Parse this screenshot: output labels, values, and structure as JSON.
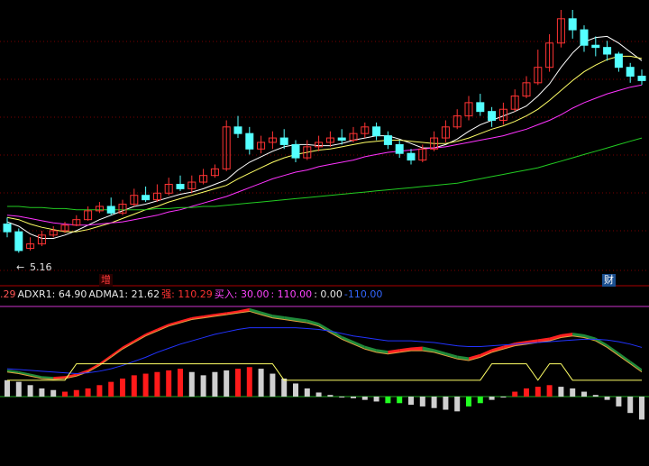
{
  "colors": {
    "background": "#000000",
    "grid": "#7a0000",
    "up_candle": "#ff3333",
    "down_candle": "#54ffff",
    "ma_white": "#ffffff",
    "ma_yellow": "#ffff66",
    "ma_magenta": "#ff33ff",
    "ma_green": "#22cc22",
    "adx_red": "#ff2020",
    "adx_green": "#1f8a3a",
    "adxr_blue": "#2233ff",
    "hist_red": "#ff1a1a",
    "hist_grey": "#cfcfcf",
    "hist_green": "#22ff22"
  },
  "price_panel": {
    "low_marker": "5.16",
    "low_arrow": "←",
    "tag_increase": "增",
    "tag_finance": "财"
  },
  "indicator_bar": {
    "items": [
      {
        "label": "",
        "value": ".29",
        "color": "#ff5555"
      },
      {
        "label": "ADXR1: ",
        "value": "64.90",
        "color": "#e8e8e8"
      },
      {
        "label": "ADMA1: ",
        "value": "21.62",
        "color": "#e8e8e8"
      },
      {
        "label": "强: ",
        "value": "110.29",
        "color": "#ff3333"
      },
      {
        "label": "买入: ",
        "value": "30.00",
        "color": "#ff44ff"
      },
      {
        "label": ": ",
        "value": "110.00",
        "color": "#ff44ff"
      },
      {
        "label": ": ",
        "value": "0.00",
        "color": "#e8e8e8"
      },
      {
        "label": "",
        "value": "-110.00",
        "color": "#3366ff"
      }
    ]
  },
  "chart_data": [
    {
      "type": "candlestick",
      "candles": [
        [
          5.42,
          5.35,
          5.48,
          5.3
        ],
        [
          5.35,
          5.18,
          5.38,
          5.16
        ],
        [
          5.2,
          5.24,
          5.3,
          5.18
        ],
        [
          5.24,
          5.32,
          5.36,
          5.22
        ],
        [
          5.32,
          5.36,
          5.4,
          5.3
        ],
        [
          5.36,
          5.41,
          5.44,
          5.34
        ],
        [
          5.41,
          5.46,
          5.5,
          5.4
        ],
        [
          5.46,
          5.54,
          5.58,
          5.45
        ],
        [
          5.54,
          5.58,
          5.62,
          5.52
        ],
        [
          5.58,
          5.52,
          5.66,
          5.5
        ],
        [
          5.52,
          5.6,
          5.64,
          5.5
        ],
        [
          5.6,
          5.68,
          5.74,
          5.58
        ],
        [
          5.68,
          5.64,
          5.76,
          5.62
        ],
        [
          5.64,
          5.7,
          5.78,
          5.62
        ],
        [
          5.7,
          5.78,
          5.84,
          5.68
        ],
        [
          5.78,
          5.74,
          5.86,
          5.72
        ],
        [
          5.74,
          5.8,
          5.86,
          5.7
        ],
        [
          5.8,
          5.86,
          5.92,
          5.78
        ],
        [
          5.86,
          5.92,
          5.96,
          5.84
        ],
        [
          5.92,
          6.3,
          6.36,
          5.9
        ],
        [
          6.3,
          6.24,
          6.4,
          6.2
        ],
        [
          6.24,
          6.1,
          6.3,
          6.05
        ],
        [
          6.1,
          6.16,
          6.22,
          6.06
        ],
        [
          6.16,
          6.2,
          6.26,
          6.1
        ],
        [
          6.2,
          6.14,
          6.28,
          6.1
        ],
        [
          6.14,
          6.02,
          6.18,
          5.98
        ],
        [
          6.02,
          6.12,
          6.18,
          6.0
        ],
        [
          6.12,
          6.16,
          6.22,
          6.08
        ],
        [
          6.16,
          6.2,
          6.26,
          6.12
        ],
        [
          6.2,
          6.18,
          6.28,
          6.14
        ],
        [
          6.18,
          6.24,
          6.3,
          6.16
        ],
        [
          6.24,
          6.3,
          6.34,
          6.2
        ],
        [
          6.3,
          6.22,
          6.34,
          6.18
        ],
        [
          6.22,
          6.14,
          6.26,
          6.1
        ],
        [
          6.14,
          6.06,
          6.18,
          6.02
        ],
        [
          6.06,
          6.0,
          6.1,
          5.96
        ],
        [
          6.0,
          6.1,
          6.14,
          5.98
        ],
        [
          6.1,
          6.2,
          6.26,
          6.08
        ],
        [
          6.2,
          6.3,
          6.36,
          6.16
        ],
        [
          6.3,
          6.4,
          6.46,
          6.28
        ],
        [
          6.4,
          6.52,
          6.58,
          6.36
        ],
        [
          6.52,
          6.44,
          6.6,
          6.4
        ],
        [
          6.44,
          6.36,
          6.48,
          6.3
        ],
        [
          6.36,
          6.46,
          6.52,
          6.32
        ],
        [
          6.46,
          6.58,
          6.64,
          6.44
        ],
        [
          6.58,
          6.7,
          6.76,
          6.56
        ],
        [
          6.7,
          6.84,
          7.0,
          6.68
        ],
        [
          6.84,
          7.06,
          7.14,
          6.8
        ],
        [
          7.06,
          7.28,
          7.36,
          7.02
        ],
        [
          7.28,
          7.18,
          7.36,
          7.1
        ],
        [
          7.18,
          7.04,
          7.22,
          6.98
        ],
        [
          7.04,
          7.02,
          7.12,
          6.94
        ],
        [
          7.02,
          6.96,
          7.08,
          6.9
        ],
        [
          6.96,
          6.84,
          6.98,
          6.8
        ],
        [
          6.84,
          6.76,
          6.88,
          6.7
        ],
        [
          6.76,
          6.72,
          6.82,
          6.68
        ]
      ],
      "ma": [
        {
          "name": "white",
          "values": [
            5.44,
            5.4,
            5.33,
            5.29,
            5.29,
            5.32,
            5.36,
            5.41,
            5.46,
            5.5,
            5.54,
            5.58,
            5.6,
            5.63,
            5.66,
            5.69,
            5.71,
            5.74,
            5.78,
            5.82,
            5.91,
            5.98,
            6.03,
            6.08,
            6.12,
            6.14,
            6.14,
            6.13,
            6.13,
            6.15,
            6.18,
            6.2,
            6.22,
            6.22,
            6.19,
            6.15,
            6.11,
            6.11,
            6.14,
            6.19,
            6.26,
            6.32,
            6.36,
            6.4,
            6.44,
            6.49,
            6.58,
            6.69,
            6.84,
            6.97,
            7.07,
            7.11,
            7.12,
            7.06,
            6.98,
            6.9
          ]
        },
        {
          "name": "yellow",
          "values": [
            5.48,
            5.46,
            5.42,
            5.39,
            5.37,
            5.35,
            5.35,
            5.37,
            5.4,
            5.43,
            5.47,
            5.51,
            5.55,
            5.58,
            5.62,
            5.65,
            5.68,
            5.71,
            5.74,
            5.77,
            5.83,
            5.88,
            5.93,
            5.98,
            6.02,
            6.05,
            6.07,
            6.09,
            6.1,
            6.12,
            6.14,
            6.16,
            6.17,
            6.18,
            6.18,
            6.17,
            6.16,
            6.15,
            6.15,
            6.17,
            6.2,
            6.24,
            6.28,
            6.31,
            6.35,
            6.4,
            6.46,
            6.54,
            6.63,
            6.72,
            6.8,
            6.86,
            6.91,
            6.94,
            6.94,
            6.92
          ]
        },
        {
          "name": "magenta",
          "values": [
            5.5,
            5.49,
            5.47,
            5.45,
            5.43,
            5.42,
            5.41,
            5.41,
            5.42,
            5.43,
            5.44,
            5.46,
            5.48,
            5.5,
            5.53,
            5.55,
            5.58,
            5.61,
            5.64,
            5.67,
            5.71,
            5.75,
            5.79,
            5.83,
            5.86,
            5.89,
            5.91,
            5.94,
            5.96,
            5.98,
            6.0,
            6.03,
            6.05,
            6.07,
            6.08,
            6.09,
            6.1,
            6.11,
            6.12,
            6.14,
            6.16,
            6.18,
            6.2,
            6.22,
            6.25,
            6.28,
            6.32,
            6.36,
            6.41,
            6.47,
            6.52,
            6.56,
            6.6,
            6.63,
            6.66,
            6.68
          ]
        },
        {
          "name": "green",
          "values": [
            5.58,
            5.58,
            5.57,
            5.57,
            5.56,
            5.56,
            5.55,
            5.55,
            5.55,
            5.55,
            5.55,
            5.55,
            5.55,
            5.56,
            5.56,
            5.57,
            5.57,
            5.58,
            5.58,
            5.59,
            5.6,
            5.61,
            5.62,
            5.63,
            5.64,
            5.65,
            5.66,
            5.67,
            5.68,
            5.69,
            5.7,
            5.71,
            5.72,
            5.73,
            5.74,
            5.75,
            5.76,
            5.77,
            5.78,
            5.79,
            5.81,
            5.83,
            5.85,
            5.87,
            5.89,
            5.91,
            5.93,
            5.96,
            5.99,
            6.02,
            6.05,
            6.08,
            6.11,
            6.14,
            6.17,
            6.2
          ]
        }
      ],
      "ylim": [
        5.0,
        7.45
      ]
    },
    {
      "type": "mixed",
      "ylim": [
        -40,
        110
      ],
      "adx": [
        30,
        28,
        25,
        22,
        21,
        22,
        25,
        30,
        38,
        48,
        58,
        66,
        74,
        80,
        86,
        90,
        94,
        96,
        98,
        100,
        102,
        104,
        100,
        96,
        94,
        92,
        90,
        86,
        78,
        70,
        64,
        58,
        54,
        52,
        54,
        56,
        56,
        54,
        50,
        46,
        44,
        48,
        54,
        58,
        62,
        64,
        66,
        68,
        72,
        74,
        72,
        68,
        60,
        50,
        40,
        30
      ],
      "adxr": [
        34,
        33,
        32,
        31,
        30,
        29,
        28,
        29,
        31,
        34,
        38,
        43,
        48,
        54,
        59,
        64,
        68,
        72,
        76,
        79,
        82,
        84,
        84,
        84,
        84,
        84,
        83,
        82,
        80,
        77,
        74,
        72,
        70,
        68,
        68,
        68,
        67,
        66,
        64,
        62,
        61,
        61,
        62,
        63,
        64,
        65,
        66,
        67,
        68,
        69,
        70,
        70,
        69,
        67,
        64,
        60
      ],
      "adx_band": [
        33,
        31,
        28,
        25,
        24,
        25,
        28,
        33,
        41,
        51,
        61,
        69,
        77,
        83,
        89,
        93,
        97,
        99,
        101,
        103,
        105,
        108,
        104,
        100,
        98,
        96,
        94,
        90,
        82,
        74,
        68,
        62,
        58,
        56,
        58,
        60,
        61,
        58,
        54,
        50,
        48,
        52,
        58,
        62,
        66,
        68,
        70,
        72,
        76,
        78,
        76,
        72,
        64,
        54,
        44,
        34
      ],
      "histogram": [
        20,
        18,
        14,
        10,
        8,
        6,
        8,
        10,
        14,
        18,
        22,
        26,
        28,
        30,
        32,
        34,
        30,
        26,
        30,
        32,
        34,
        36,
        34,
        28,
        22,
        16,
        10,
        5,
        2,
        0,
        -2,
        -4,
        -6,
        -8,
        -8,
        -10,
        -12,
        -14,
        -16,
        -18,
        -12,
        -8,
        -4,
        0,
        6,
        10,
        12,
        14,
        12,
        10,
        6,
        2,
        -4,
        -12,
        -20,
        -28
      ],
      "hist_colors": [
        "grey",
        "grey",
        "grey",
        "grey",
        "grey",
        "red",
        "red",
        "red",
        "red",
        "red",
        "red",
        "red",
        "red",
        "red",
        "red",
        "red",
        "grey",
        "grey",
        "grey",
        "grey",
        "red",
        "red",
        "grey",
        "grey",
        "grey",
        "grey",
        "grey",
        "grey",
        "grey",
        "grey",
        "grey",
        "grey",
        "grey",
        "green",
        "green",
        "grey",
        "grey",
        "grey",
        "grey",
        "grey",
        "green",
        "green",
        "grey",
        "grey",
        "red",
        "red",
        "red",
        "red",
        "grey",
        "grey",
        "grey",
        "grey",
        "grey",
        "grey",
        "grey",
        "grey"
      ],
      "signal_line": [
        20,
        20,
        20,
        20,
        20,
        20,
        40,
        40,
        40,
        40,
        40,
        40,
        40,
        40,
        40,
        40,
        40,
        40,
        40,
        40,
        40,
        40,
        40,
        40,
        20,
        20,
        20,
        20,
        20,
        20,
        20,
        20,
        20,
        20,
        20,
        20,
        20,
        20,
        20,
        20,
        20,
        20,
        40,
        40,
        40,
        40,
        20,
        40,
        40,
        20,
        20,
        20,
        20,
        20,
        20,
        20
      ]
    }
  ]
}
